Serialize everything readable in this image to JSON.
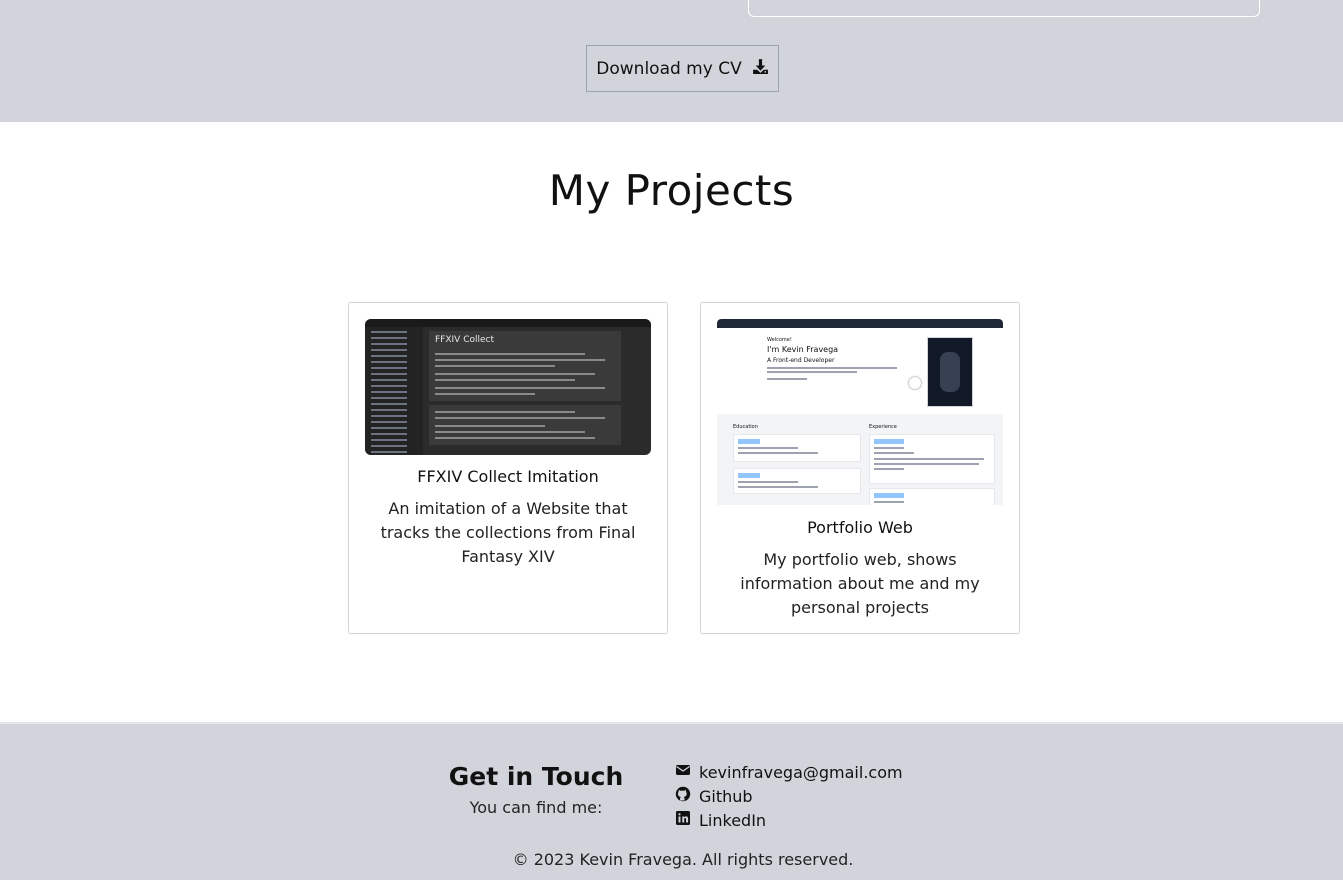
{
  "header": {
    "cv_button_label": "Download my CV",
    "cv_button_icon": "download-icon"
  },
  "projects": {
    "title": "My Projects",
    "items": [
      {
        "title": "FFXIV Collect Imitation",
        "description": "An imitation of a Website that tracks the collections from Final Fantasy XIV",
        "thumbnail_heading": "FFXIV Collect"
      },
      {
        "title": "Portfolio Web",
        "description": "My portfolio web, shows information about me and my personal projects",
        "thumbnail_name": "I'm Kevin Fravega",
        "thumbnail_subtitle": "A Front-end Developer",
        "thumbnail_welcome": "Welcome!",
        "thumbnail_education": "Education",
        "thumbnail_experience": "Experience"
      }
    ]
  },
  "footer": {
    "title": "Get in Touch",
    "subtitle": "You can find me:",
    "contacts": [
      {
        "label": "kevinfravega@gmail.com",
        "icon": "envelope-icon"
      },
      {
        "label": "Github",
        "icon": "github-icon"
      },
      {
        "label": "LinkedIn",
        "icon": "linkedin-icon"
      }
    ],
    "copyright": "© 2023 Kevin Fravega. All rights reserved."
  },
  "colors": {
    "band_background": "#d1d5db",
    "page_background": "#ffffff",
    "text": "#111111"
  }
}
